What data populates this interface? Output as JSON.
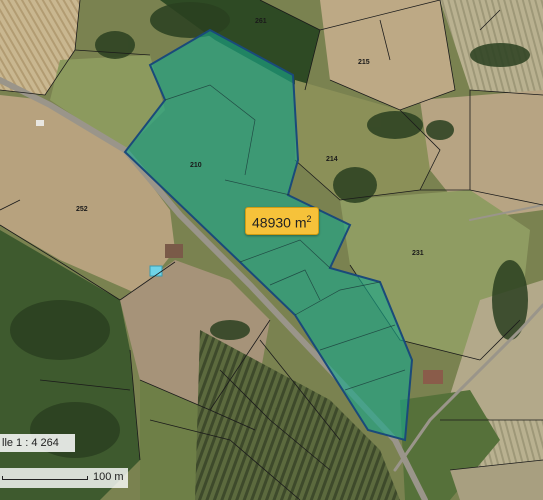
{
  "map": {
    "parcel_numbers": [
      "261",
      "215",
      "210",
      "214",
      "252",
      "231"
    ],
    "selection_color": "#19a88a",
    "selection_border": "#1a4a7a",
    "area": {
      "value": "48930 m",
      "unit_superscript": "2",
      "badge_color": "#f6c23a"
    },
    "scale": {
      "ratio_text": "lle 1 : 4 264",
      "bar_label": "100 m"
    }
  }
}
